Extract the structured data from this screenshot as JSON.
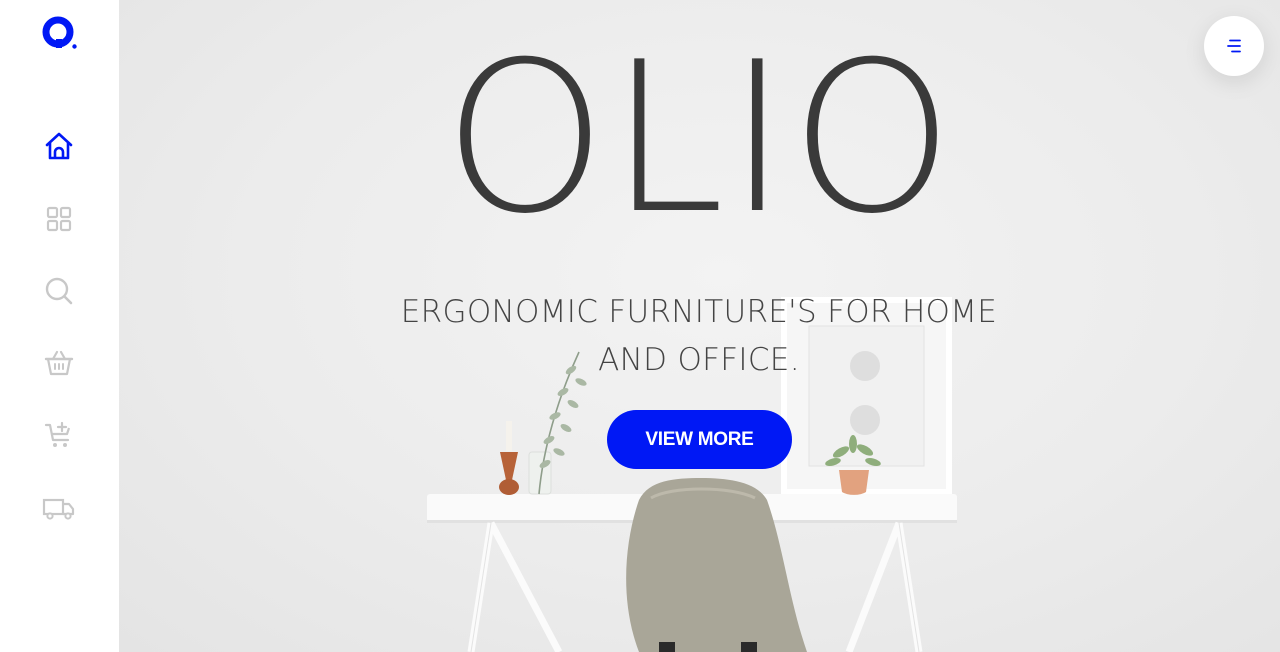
{
  "brand": {
    "logo_icon": "o-logo-icon",
    "title": "OLIO"
  },
  "hero": {
    "tagline_line1": "ERGONOMIC FURNITURE'S FOR HOME",
    "tagline_line2": "AND OFFICE.",
    "cta_label": "VIEW MORE"
  },
  "sidebar": {
    "items": [
      {
        "icon": "home-icon",
        "active": true
      },
      {
        "icon": "grid-icon",
        "active": false
      },
      {
        "icon": "search-icon",
        "active": false
      },
      {
        "icon": "basket-icon",
        "active": false
      },
      {
        "icon": "add-to-cart-icon",
        "active": false
      },
      {
        "icon": "delivery-truck-icon",
        "active": false
      }
    ]
  },
  "menu": {
    "icon": "menu-icon"
  },
  "colors": {
    "accent": "#0018f5",
    "icon_inactive": "#c8c8c8",
    "headline": "#3a3a3a"
  }
}
